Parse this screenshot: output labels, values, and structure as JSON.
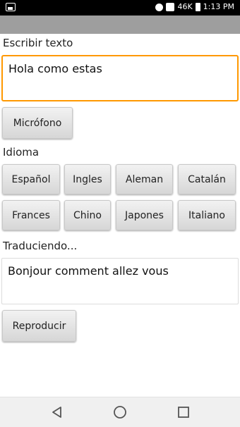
{
  "status_bar": {
    "signal_label": "46K",
    "time": "1:13 PM"
  },
  "write": {
    "label": "Escribir texto",
    "value": "Hola como estas"
  },
  "microphone_button": "Micrófono",
  "language": {
    "label": "Idioma",
    "buttons": [
      "Español",
      "Ingles",
      "Aleman",
      "Catalán",
      "Frances",
      "Chino",
      "Japones",
      "Italiano"
    ]
  },
  "translating": {
    "label": "Traduciendo...",
    "value": "Bonjour comment allez vous"
  },
  "play_button": "Reproducir",
  "nav": {
    "back_icon": "back-triangle-icon",
    "home_icon": "home-circle-icon",
    "recents_icon": "recents-square-icon"
  },
  "colors": {
    "status_bar": "#000000",
    "app_bar": "#9e9e9e",
    "focus_border": "#ff9800",
    "nav_bar": "#f0f0f0"
  }
}
